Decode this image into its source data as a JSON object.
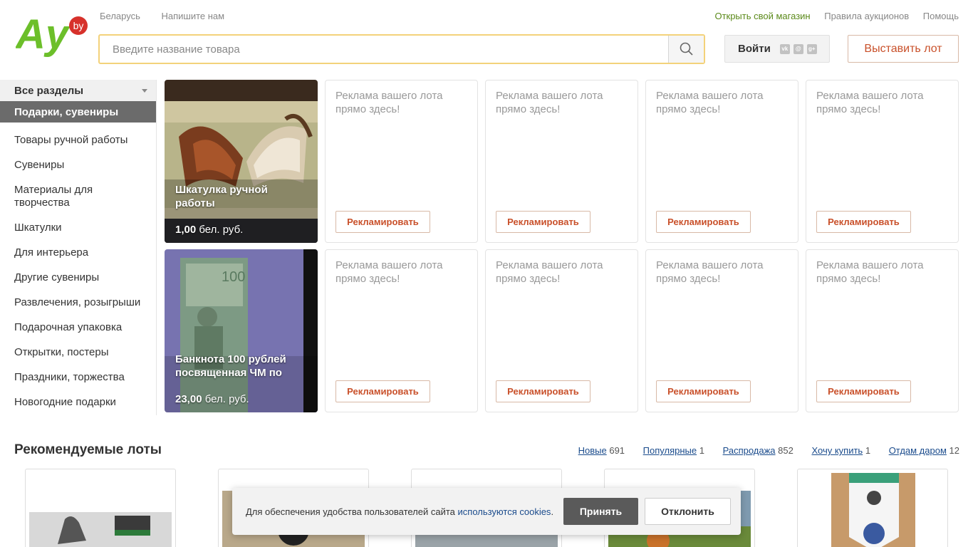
{
  "header": {
    "logo_text": "Ay",
    "logo_suffix": "by",
    "region": "Беларусь",
    "write_us": "Напишите нам",
    "open_shop": "Открыть свой магазин",
    "rules": "Правила аукционов",
    "help": "Помощь",
    "search_placeholder": "Введите название товара",
    "login_label": "Войти",
    "sell_label": "Выставить лот",
    "brand_green": "#6cbf2a",
    "brand_red": "#d7312b"
  },
  "sidebar": {
    "all_sections": "Все разделы",
    "active_section": "Подарки, сувениры",
    "items": [
      "Товары ручной работы",
      "Сувениры",
      "Материалы для творчества",
      "Шкатулки",
      "Для интерьера",
      "Другие сувениры",
      "Развлечения, розыгрыши",
      "Подарочная упаковка",
      "Открытки, постеры",
      "Праздники, торжества",
      "Новогодние подарки"
    ]
  },
  "featured": [
    {
      "title": "Шкатулка ручной работы",
      "price": "1,00",
      "currency": "бел. руб."
    },
    {
      "title": "Банкнота 100 рублей посвященная ЧМ по",
      "price": "23,00",
      "currency": "бел. руб."
    }
  ],
  "ad": {
    "text": "Реклама вашего лота прямо здесь!",
    "button": "Рекламировать"
  },
  "recommended": {
    "title": "Рекомендуемые лоты",
    "tabs": [
      {
        "label": "Новые",
        "count": "691"
      },
      {
        "label": "Популярные",
        "count": "1"
      },
      {
        "label": "Распродажа",
        "count": "852"
      },
      {
        "label": "Хочу купить",
        "count": "1"
      },
      {
        "label": "Отдам даром",
        "count": "12"
      }
    ]
  },
  "cookie": {
    "text": "Для обеспечения удобства пользователей сайта ",
    "link": "используются cookies",
    "period": ".",
    "accept": "Принять",
    "decline": "Отклонить"
  }
}
